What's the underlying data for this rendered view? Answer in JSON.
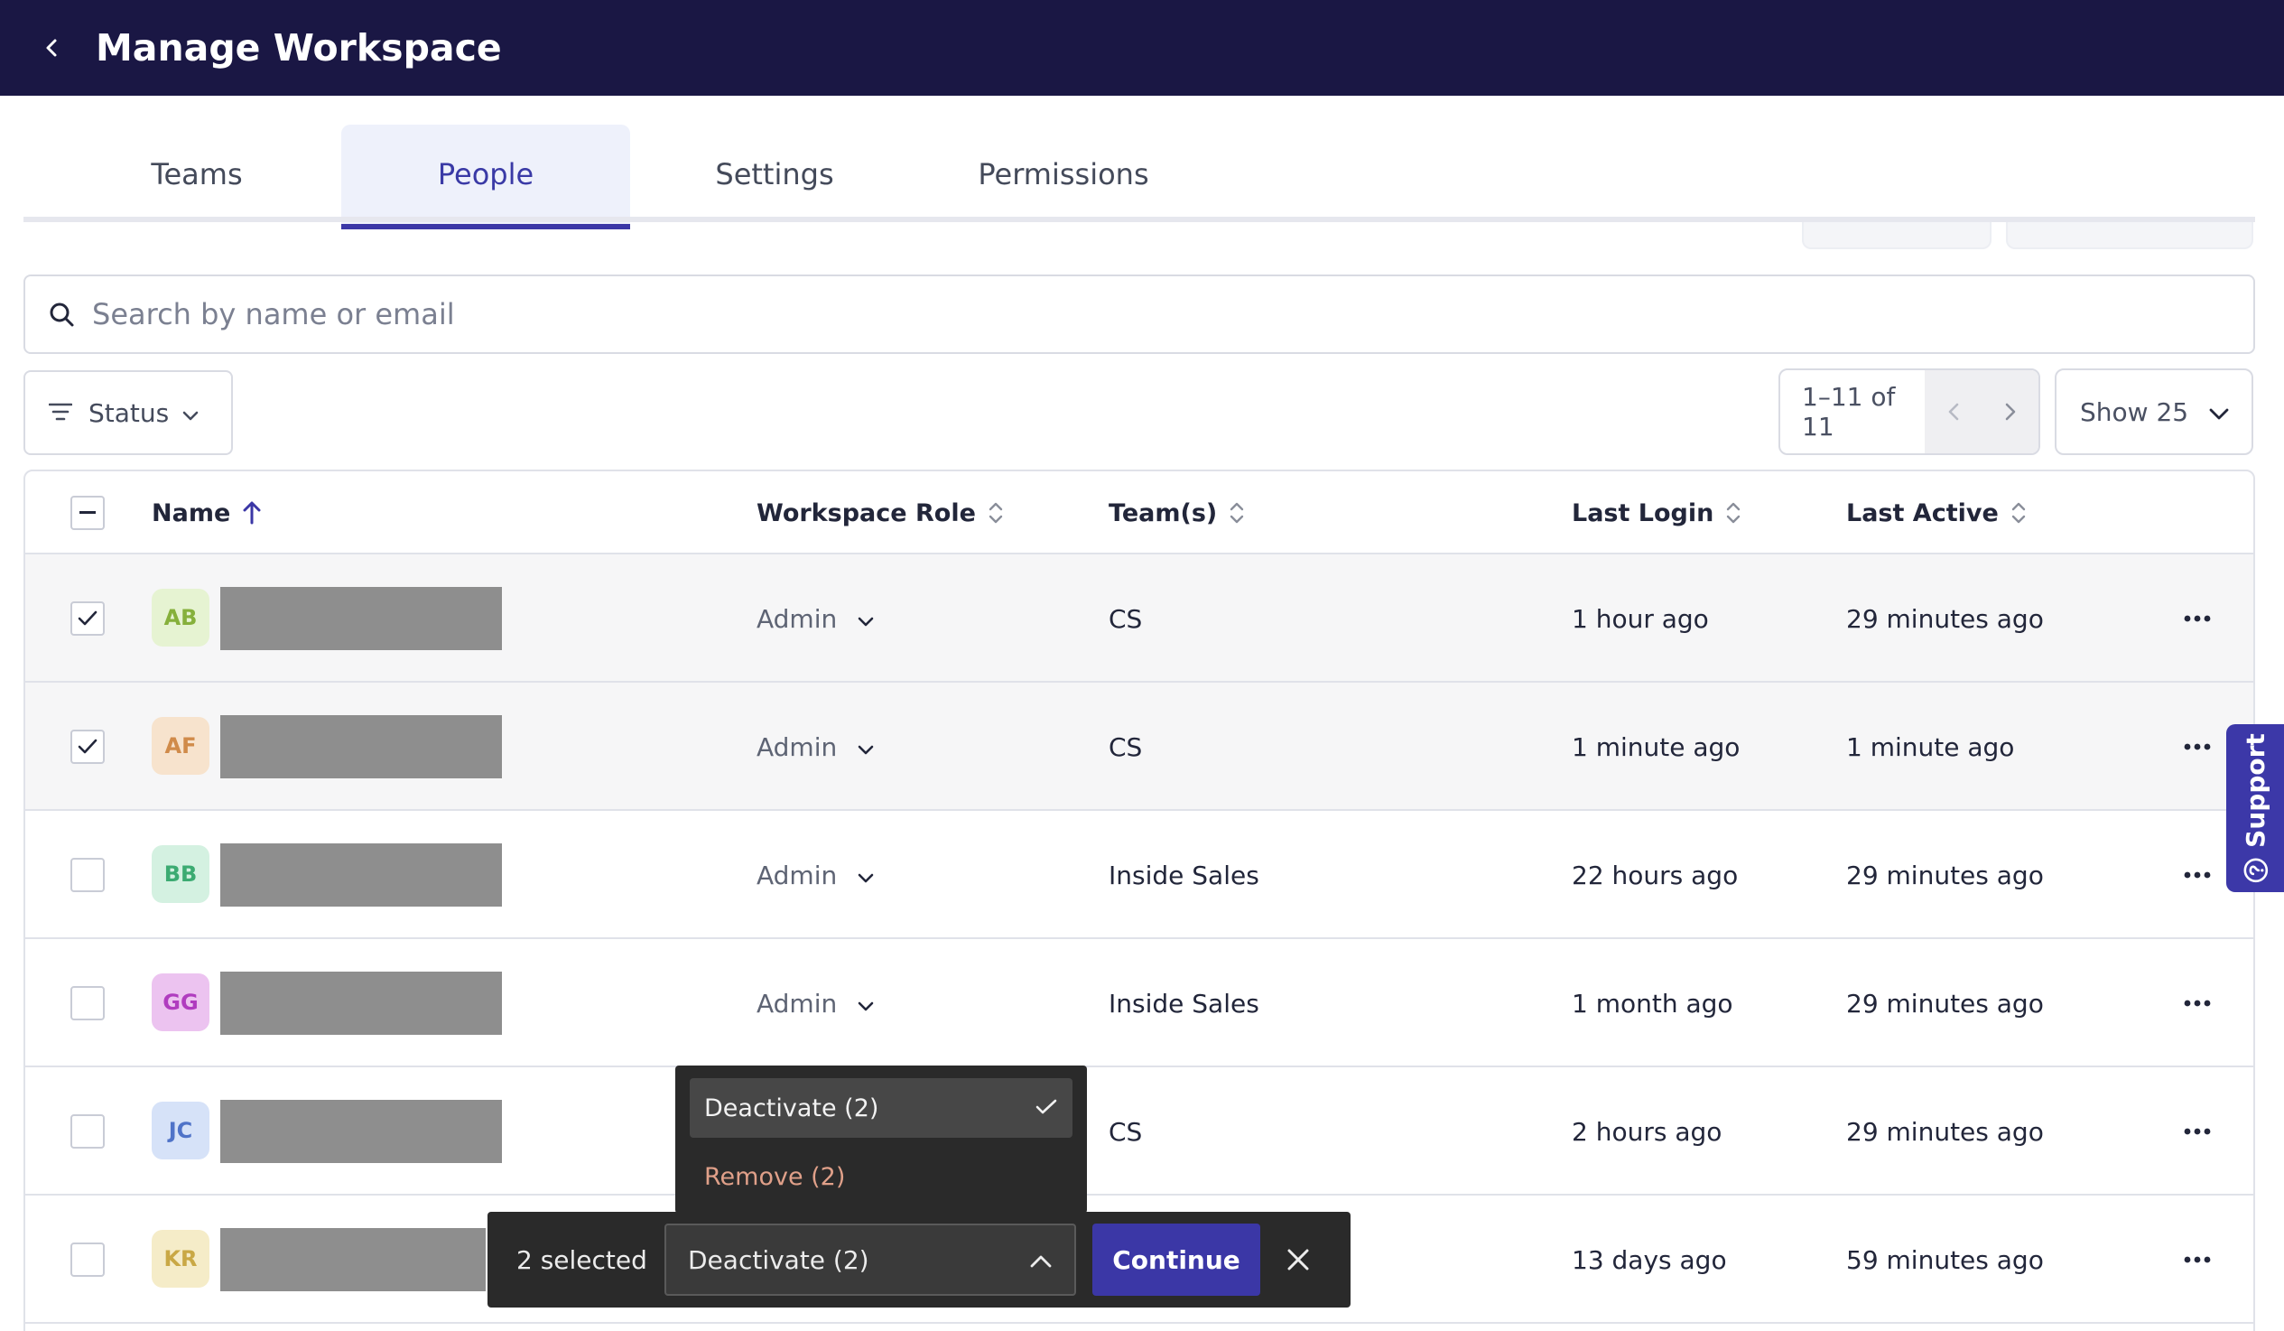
{
  "header": {
    "title": "Manage Workspace",
    "back_icon": "chevron-left-icon"
  },
  "tabs": [
    {
      "label": "Teams",
      "active": false
    },
    {
      "label": "People",
      "active": true
    },
    {
      "label": "Settings",
      "active": false
    },
    {
      "label": "Permissions",
      "active": false
    }
  ],
  "search": {
    "placeholder": "Search by name or email",
    "value": ""
  },
  "filter": {
    "label": "Status"
  },
  "pagination": {
    "range": "1–11 of 11",
    "page_size_label": "Show 25"
  },
  "table": {
    "columns": {
      "name": "Name",
      "role": "Workspace Role",
      "teams": "Team(s)",
      "last_login": "Last Login",
      "last_active": "Last Active"
    },
    "rows": [
      {
        "initials": "AB",
        "role": "Admin",
        "team": "CS",
        "last_login": "1 hour ago",
        "last_active": "29 minutes ago",
        "checked": true,
        "avatar_bg": "#e6f3d2",
        "avatar_fg": "#86b03b"
      },
      {
        "initials": "AF",
        "role": "Admin",
        "team": "CS",
        "last_login": "1 minute ago",
        "last_active": "1 minute ago",
        "checked": true,
        "avatar_bg": "#f7e3cd",
        "avatar_fg": "#d08b4a"
      },
      {
        "initials": "BB",
        "role": "Admin",
        "team": "Inside Sales",
        "last_login": "22 hours ago",
        "last_active": "29 minutes ago",
        "checked": false,
        "avatar_bg": "#d4f1e1",
        "avatar_fg": "#3cab72"
      },
      {
        "initials": "GG",
        "role": "Admin",
        "team": "Inside Sales",
        "last_login": "1 month ago",
        "last_active": "29 minutes ago",
        "checked": false,
        "avatar_bg": "#ecc3f0",
        "avatar_fg": "#b03cbf"
      },
      {
        "initials": "JC",
        "role": "",
        "team": "CS",
        "last_login": "2 hours ago",
        "last_active": "29 minutes ago",
        "checked": false,
        "avatar_bg": "#d6e2f8",
        "avatar_fg": "#4f73c8"
      },
      {
        "initials": "KR",
        "role": "",
        "team": "",
        "last_login": "13 days ago",
        "last_active": "59 minutes ago",
        "checked": false,
        "avatar_bg": "#f5ecc8",
        "avatar_fg": "#c9a845"
      }
    ]
  },
  "support": {
    "label": "Support"
  },
  "bulk_action": {
    "selected_text": "2 selected",
    "selected_option": "Deactivate (2)",
    "options": [
      "Deactivate (2)",
      "Remove (2)"
    ],
    "continue_label": "Continue"
  },
  "colors": {
    "header_bg": "#1a1744",
    "accent": "#3b37a6",
    "danger_text": "#e0a089"
  }
}
